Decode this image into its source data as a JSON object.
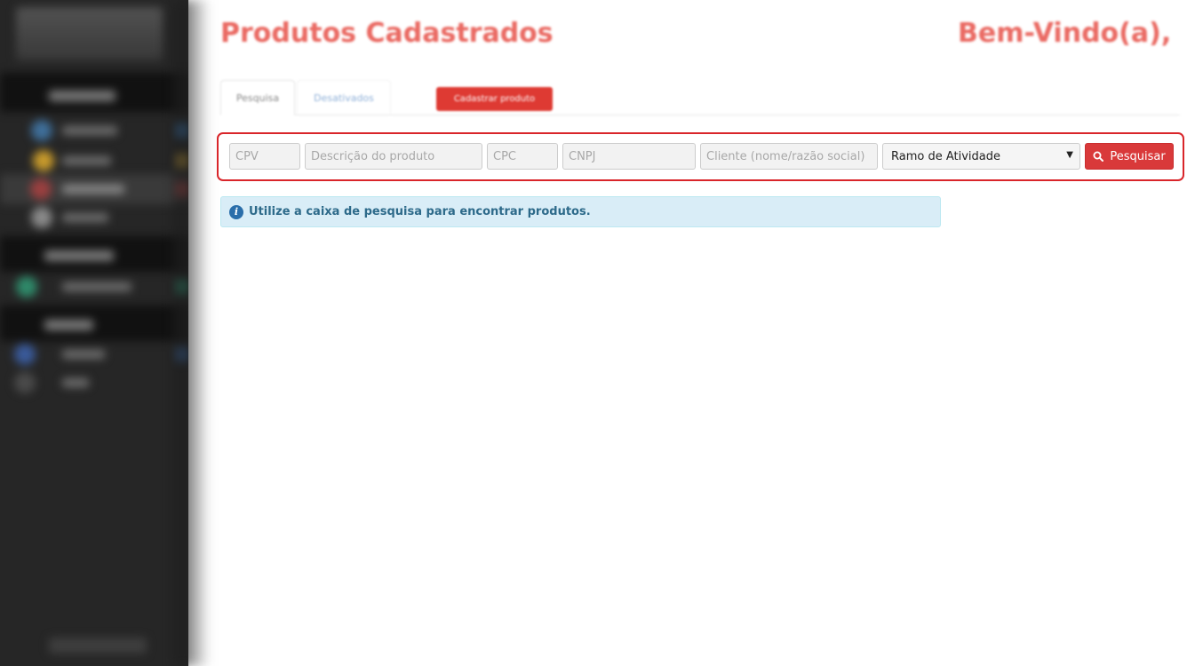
{
  "header": {
    "title": "Produtos Cadastrados",
    "welcome": "Bem-Vindo(a),"
  },
  "tabs": [
    {
      "label": "Pesquisa",
      "active": true
    },
    {
      "label": "Desativados",
      "active": false
    }
  ],
  "actions": {
    "cadastrar_label": "Cadastrar produto"
  },
  "search": {
    "cpv_placeholder": "CPV",
    "descricao_placeholder": "Descrição do produto",
    "cpc_placeholder": "CPC",
    "cnpj_placeholder": "CNPJ",
    "cliente_placeholder": "Cliente (nome/razão social)",
    "ramo_selected": "Ramo de Atividade",
    "button_label": "Pesquisar",
    "button_icon": "search-icon"
  },
  "alert": {
    "icon": "info-icon",
    "icon_glyph": "i",
    "text": "Utilize a caixa de pesquisa para encontrar produtos."
  },
  "colors": {
    "brand_red": "#d9393a",
    "title_red": "#ea6a63",
    "highlight_border": "#d9252a",
    "info_bg": "#d9edf7",
    "sidebar_bg": "#262626"
  }
}
